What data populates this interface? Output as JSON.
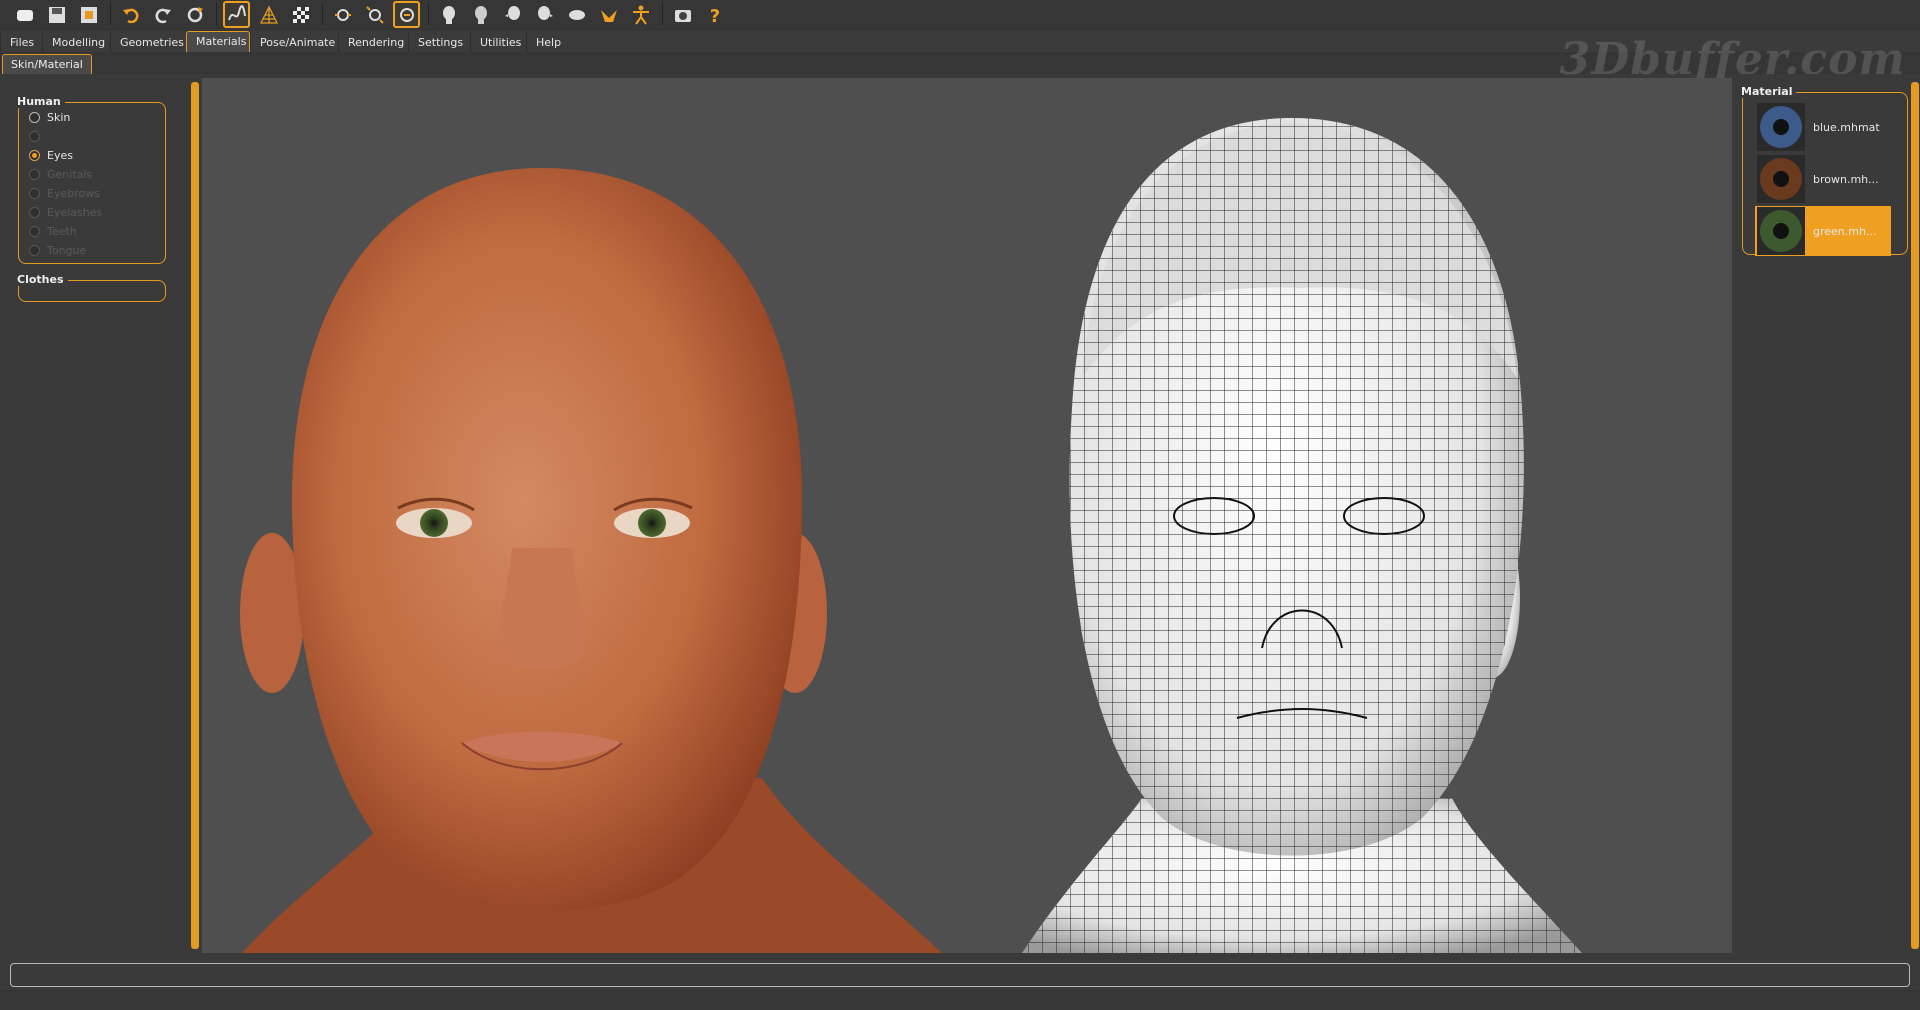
{
  "toolbar": {
    "buttons": [
      {
        "name": "new-icon"
      },
      {
        "name": "save-icon"
      },
      {
        "name": "export-icon"
      },
      {
        "name": "undo-icon"
      },
      {
        "name": "redo-icon"
      },
      {
        "name": "reset-icon"
      },
      {
        "name": "smooth-icon",
        "active": true
      },
      {
        "name": "wireframe-icon"
      },
      {
        "name": "background-icon"
      },
      {
        "name": "front-view-icon"
      },
      {
        "name": "back-view-icon"
      },
      {
        "name": "side-view-icon",
        "active": true
      },
      {
        "name": "head-front-icon"
      },
      {
        "name": "head-back-icon"
      },
      {
        "name": "head-left-icon"
      },
      {
        "name": "head-right-icon"
      },
      {
        "name": "top-view-icon"
      },
      {
        "name": "bottom-view-icon"
      },
      {
        "name": "pose-icon"
      },
      {
        "name": "camera-icon"
      },
      {
        "name": "help-icon"
      }
    ]
  },
  "menu": {
    "tabs": [
      "Files",
      "Modelling",
      "Geometries",
      "Materials",
      "Pose/Animate",
      "Rendering",
      "Settings",
      "Utilities",
      "Help"
    ],
    "active": "Materials"
  },
  "subtab": {
    "label": "Skin/Material"
  },
  "watermark": "3Dbuffer.com",
  "human_group": {
    "title": "Human",
    "options": [
      {
        "label": "Skin",
        "checked": false,
        "enabled": true
      },
      {
        "label": "",
        "checked": false,
        "enabled": false
      },
      {
        "label": "Eyes",
        "checked": true,
        "enabled": true
      },
      {
        "label": "Genitals",
        "checked": false,
        "enabled": false
      },
      {
        "label": "Eyebrows",
        "checked": false,
        "enabled": false
      },
      {
        "label": "Eyelashes",
        "checked": false,
        "enabled": false
      },
      {
        "label": "Teeth",
        "checked": false,
        "enabled": false
      },
      {
        "label": "Tongue",
        "checked": false,
        "enabled": false
      }
    ]
  },
  "clothes_group": {
    "title": "Clothes"
  },
  "material_group": {
    "title": "Material",
    "items": [
      {
        "label": "blue.mhmat",
        "color": "#3d5b8a",
        "selected": false
      },
      {
        "label": "brown.mh...",
        "color": "#6a3a1e",
        "selected": false
      },
      {
        "label": "green.mh...",
        "color": "#3d5a2e",
        "selected": true
      }
    ]
  },
  "colors": {
    "accent": "#e49b22",
    "skin": "#c8744a",
    "background": "#4f4f4f"
  }
}
